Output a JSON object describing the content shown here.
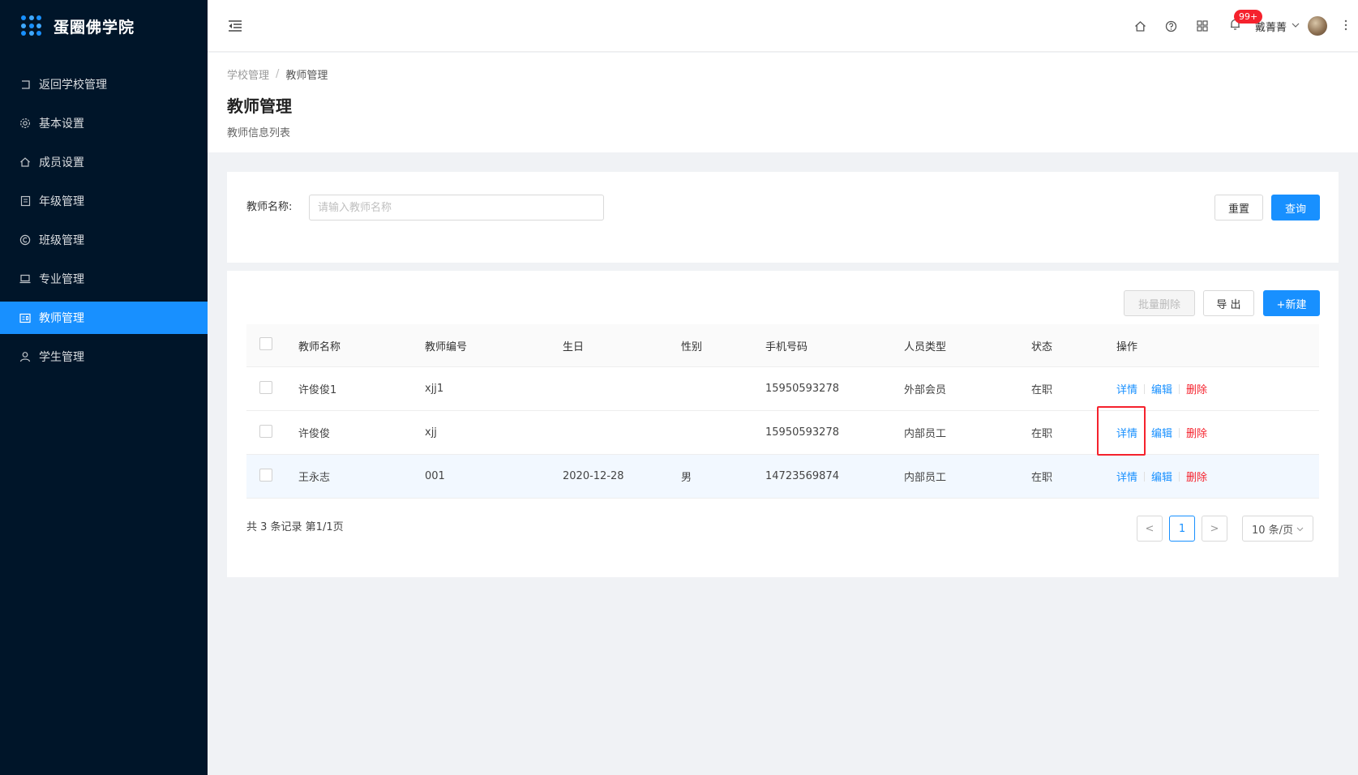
{
  "app": {
    "name": "蛋圈佛学院"
  },
  "sidebar": {
    "items": [
      {
        "label": "返回学校管理",
        "icon": "return-icon"
      },
      {
        "label": "基本设置",
        "icon": "gear-icon"
      },
      {
        "label": "成员设置",
        "icon": "home-icon"
      },
      {
        "label": "年级管理",
        "icon": "grade-icon"
      },
      {
        "label": "班级管理",
        "icon": "copyright-icon"
      },
      {
        "label": "专业管理",
        "icon": "laptop-icon"
      },
      {
        "label": "教师管理",
        "icon": "idcard-icon",
        "active": true
      },
      {
        "label": "学生管理",
        "icon": "user-icon"
      }
    ]
  },
  "header": {
    "badge": "99+",
    "user_name": "戴菁菁"
  },
  "breadcrumb": {
    "parent": "学校管理",
    "separator": "/",
    "current": "教师管理"
  },
  "page": {
    "title": "教师管理",
    "subtitle": "教师信息列表"
  },
  "search": {
    "label": "教师名称:",
    "placeholder": "请输入教师名称",
    "value": "",
    "reset_label": "重置",
    "query_label": "查询"
  },
  "toolbar": {
    "batch_delete_label": "批量删除",
    "export_label": "导 出",
    "new_label": "+新建"
  },
  "table": {
    "columns": [
      "教师名称",
      "教师编号",
      "生日",
      "性别",
      "手机号码",
      "人员类型",
      "状态",
      "操作"
    ],
    "rows": [
      {
        "name": "许俊俊1",
        "no": "xjj1",
        "birthday": "",
        "gender": "",
        "phone": "15950593278",
        "type": "外部会员",
        "status": "在职"
      },
      {
        "name": "许俊俊",
        "no": "xjj",
        "birthday": "",
        "gender": "",
        "phone": "15950593278",
        "type": "内部员工",
        "status": "在职"
      },
      {
        "name": "王永志",
        "no": "001",
        "birthday": "2020-12-28",
        "gender": "男",
        "phone": "14723569874",
        "type": "内部员工",
        "status": "在职"
      }
    ],
    "actions": {
      "detail": "详情",
      "edit": "编辑",
      "delete": "删除"
    }
  },
  "pagination": {
    "summary": "共 3 条记录 第1/1页",
    "prev": "<",
    "current_page": "1",
    "next": ">",
    "page_size": "10 条/页"
  },
  "colors": {
    "sidebar_bg": "#001529",
    "primary": "#1890ff",
    "danger": "#f5222d"
  }
}
